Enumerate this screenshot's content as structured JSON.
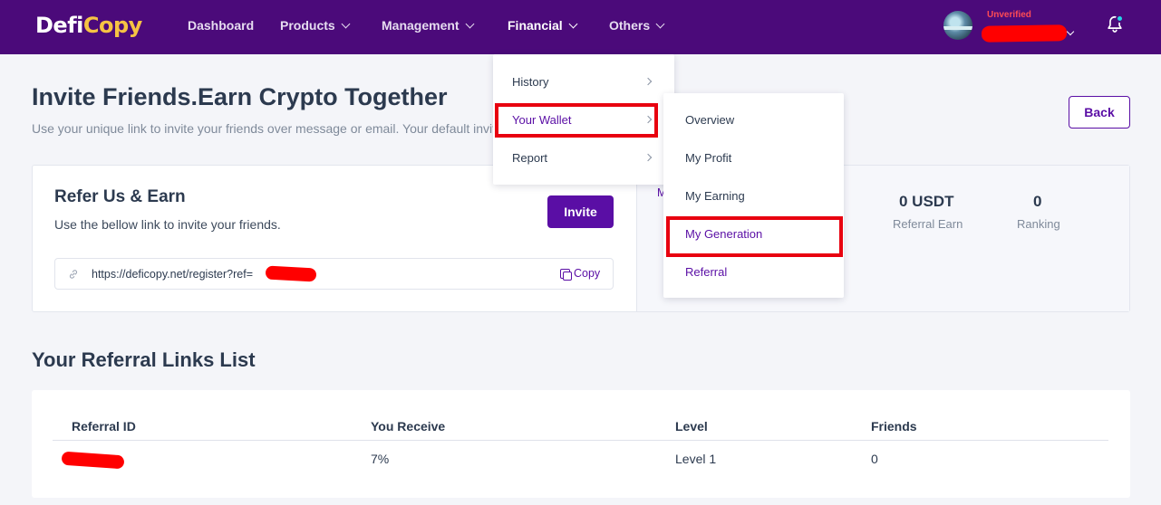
{
  "brand": {
    "logo_part1": "Defi",
    "logo_part2": "Copy",
    "color_primary": "#4b0a7a",
    "color_accent": "#5a0ea5",
    "color_logo_yellow": "#f6c343"
  },
  "nav": {
    "items": [
      {
        "label": "Dashboard"
      },
      {
        "label": "Products"
      },
      {
        "label": "Management"
      },
      {
        "label": "Financial"
      },
      {
        "label": "Others"
      }
    ],
    "user_status": "Unverified"
  },
  "financial_menu": {
    "items": [
      {
        "label": "History"
      },
      {
        "label": "Your Wallet"
      },
      {
        "label": "Report"
      }
    ]
  },
  "wallet_submenu": {
    "items": [
      {
        "label": "Overview"
      },
      {
        "label": "My Profit"
      },
      {
        "label": "My Earning"
      },
      {
        "label": "My Generation"
      },
      {
        "label": "Referral"
      }
    ]
  },
  "page": {
    "title": "Invite Friends.Earn Crypto Together",
    "subtitle": "Use your unique link to invite your friends over message or email. Your default invit",
    "back_label": "Back"
  },
  "refer_card": {
    "title": "Refer Us & Earn",
    "subtitle": "Use the bellow link to invite your friends.",
    "invite_label": "Invite",
    "link_text": "https://deficopy.net/register?ref=",
    "copy_label": "Copy",
    "partial_label": "M"
  },
  "stats": [
    {
      "value": "0 USDT",
      "label": "Referral Earn"
    },
    {
      "value": "0",
      "label": "Ranking"
    }
  ],
  "referral_list": {
    "title": "Your Referral Links List",
    "columns": [
      "Referral ID",
      "You Receive",
      "Level",
      "Friends"
    ],
    "rows": [
      {
        "referral_id": "",
        "you_receive": "7%",
        "level": "Level 1",
        "friends": "0"
      }
    ]
  }
}
